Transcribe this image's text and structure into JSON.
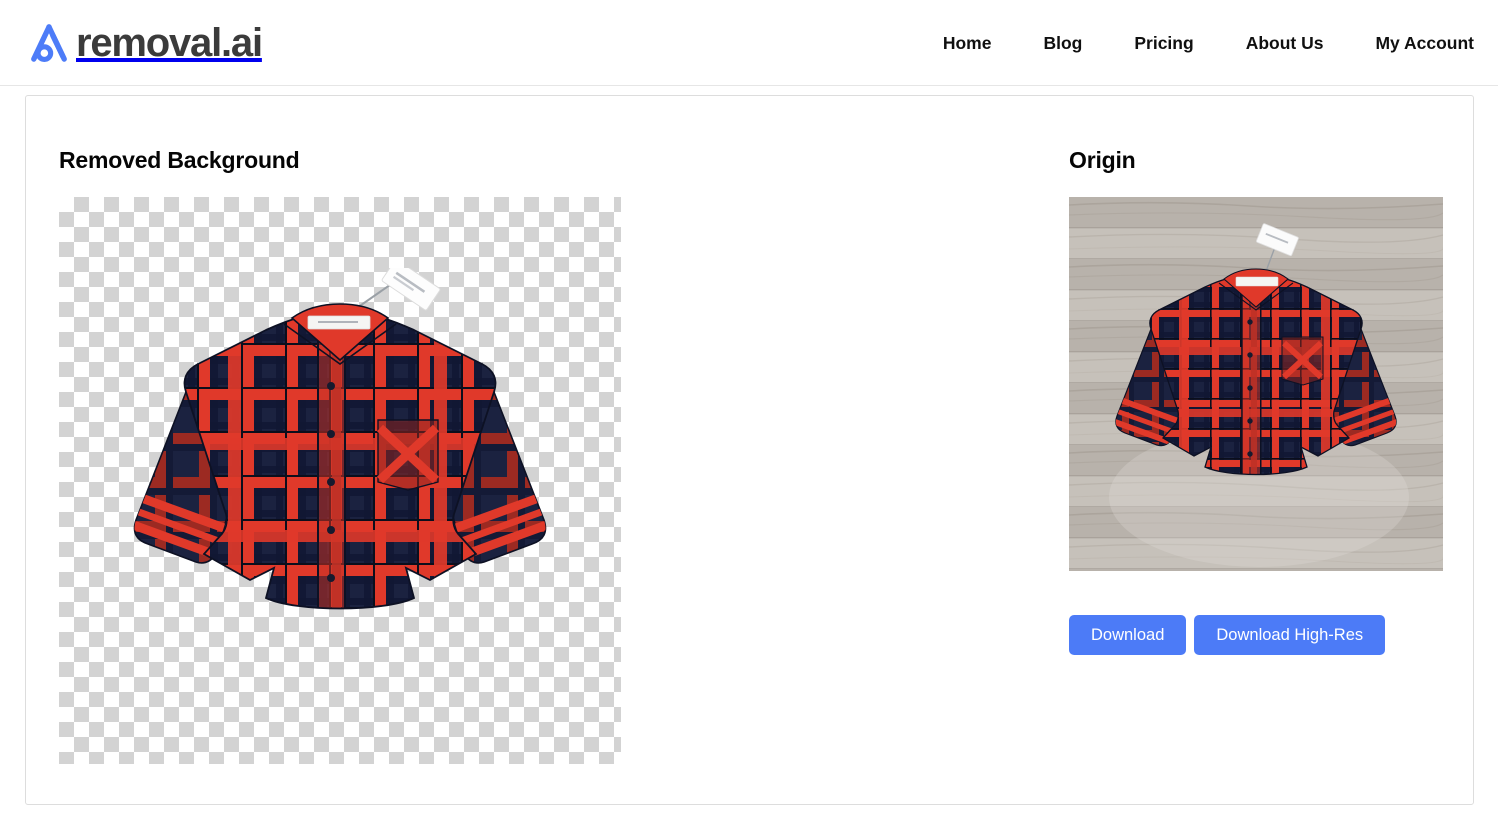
{
  "header": {
    "brand": {
      "logo_icon": "removal-ai-logo-icon",
      "name": "removal.ai",
      "logo_color": "#4d7cf8",
      "text_color": "#3b3b3b"
    },
    "nav": [
      {
        "label": "Home"
      },
      {
        "label": "Blog"
      },
      {
        "label": "Pricing"
      },
      {
        "label": "About Us"
      },
      {
        "label": "My Account"
      }
    ]
  },
  "result": {
    "left_panel": {
      "title": "Removed Background",
      "preview": "transparent-checkerboard-plaid-shirt"
    },
    "right_panel": {
      "title": "Origin",
      "preview": "original-photo-plaid-shirt-on-wood-floor"
    },
    "actions": {
      "download_label": "Download",
      "download_hires_label": "Download High-Res",
      "button_color": "#4c7bf7",
      "button_text_color": "#ffffff"
    }
  },
  "colors": {
    "page_background": "#ffffff",
    "card_border": "#dddddd",
    "header_border": "#e6e6e6",
    "checker_light": "#ffffff",
    "checker_dark": "#d3d3d3",
    "shirt_red": "#e0392a",
    "shirt_dark_red": "#962722",
    "shirt_navy": "#1b2240",
    "shirt_black": "#0d1124",
    "floor_light": "#cdc8c2",
    "floor_dark": "#a39c94"
  }
}
